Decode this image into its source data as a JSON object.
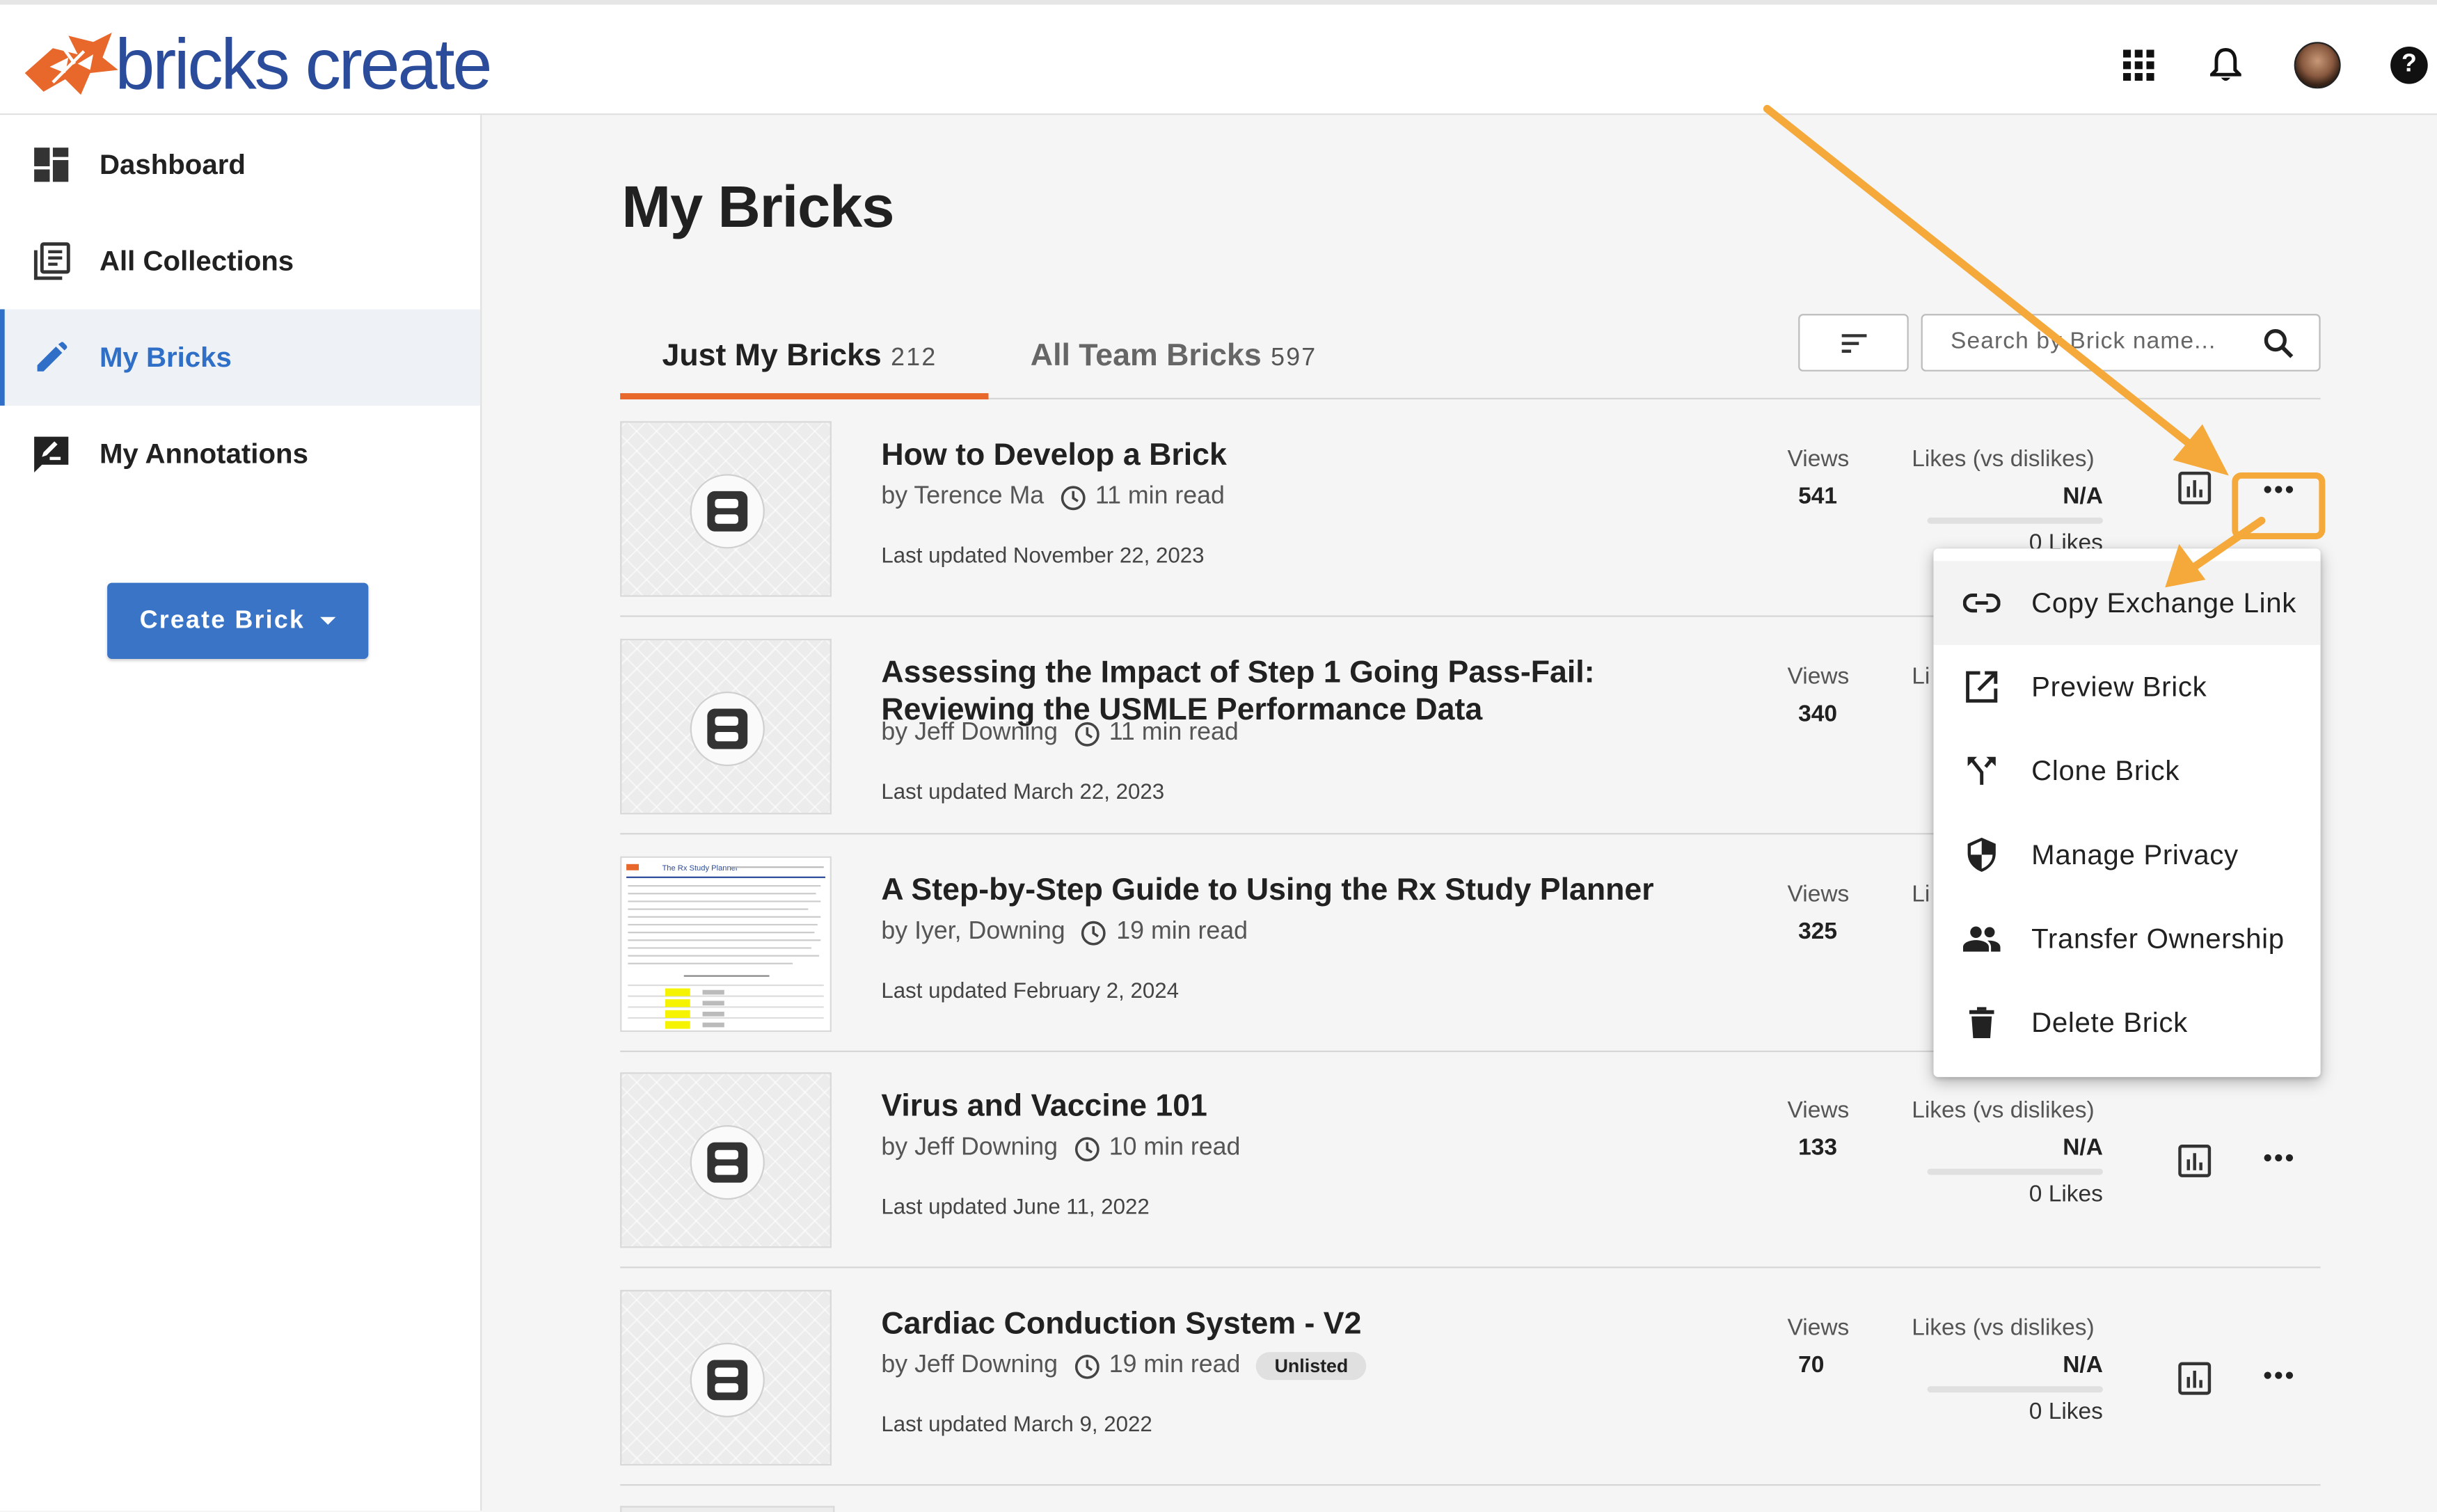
{
  "app": {
    "logo_text": "bricks create",
    "colors": {
      "brand_blue": "#2b4b9b",
      "brand_orange": "#e8672a",
      "accent": "#3a74c7",
      "annotation": "#f4a93a"
    }
  },
  "topbar": {
    "icons": [
      "apps-grid-icon",
      "bell-icon",
      "avatar",
      "help-icon"
    ],
    "help_label": "?"
  },
  "sidebar": {
    "items": [
      {
        "label": "Dashboard",
        "icon": "dashboard-icon",
        "active": false
      },
      {
        "label": "All Collections",
        "icon": "collections-icon",
        "active": false
      },
      {
        "label": "My Bricks",
        "icon": "pencil-icon",
        "active": true
      },
      {
        "label": "My Annotations",
        "icon": "annotation-icon",
        "active": false
      }
    ],
    "create_button": "Create Brick"
  },
  "main": {
    "title": "My Bricks",
    "tabs": [
      {
        "label": "Just My Bricks",
        "count": "212",
        "active": true
      },
      {
        "label": "All Team Bricks",
        "count": "597",
        "active": false
      }
    ],
    "search": {
      "placeholder": "Search by Brick name..."
    },
    "bricks": [
      {
        "title": "How to Develop a Brick",
        "author": "by Terence Ma",
        "read_time": "11 min read",
        "updated": "Last updated November 22, 2023",
        "views_label": "Views",
        "views": "541",
        "likes_label": "Likes (vs dislikes)",
        "likes_value": "N/A",
        "likes_count": "0 Likes",
        "badge": ""
      },
      {
        "title": "Assessing the Impact of Step 1 Going Pass-Fail: Reviewing the USMLE Performance Data",
        "author": "by Jeff Downing",
        "read_time": "11 min read",
        "updated": "Last updated March 22, 2023",
        "views_label": "Views",
        "views": "340",
        "likes_label": "Li",
        "likes_value": "",
        "likes_count": "",
        "badge": ""
      },
      {
        "title": "A Step-by-Step Guide to Using the Rx Study Planner",
        "author": "by Iyer, Downing",
        "read_time": "19 min read",
        "updated": "Last updated February 2, 2024",
        "views_label": "Views",
        "views": "325",
        "likes_label": "Li",
        "likes_value": "",
        "likes_count": "",
        "badge": ""
      },
      {
        "title": "Virus and Vaccine 101",
        "author": "by Jeff Downing",
        "read_time": "10 min read",
        "updated": "Last updated June 11, 2022",
        "views_label": "Views",
        "views": "133",
        "likes_label": "Likes (vs dislikes)",
        "likes_value": "N/A",
        "likes_count": "0 Likes",
        "badge": ""
      },
      {
        "title": "Cardiac Conduction System - V2",
        "author": "by Jeff Downing",
        "read_time": "19 min read",
        "updated": "Last updated March 9, 2022",
        "views_label": "Views",
        "views": "70",
        "likes_label": "Likes (vs dislikes)",
        "likes_value": "N/A",
        "likes_count": "0 Likes",
        "badge": "Unlisted"
      }
    ],
    "thumb_doc": {
      "title": "The Rx Study Planner"
    }
  },
  "menu": {
    "items": [
      {
        "label": "Copy Exchange Link",
        "icon": "link-icon"
      },
      {
        "label": "Preview Brick",
        "icon": "open-external-icon"
      },
      {
        "label": "Clone Brick",
        "icon": "fork-icon"
      },
      {
        "label": "Manage Privacy",
        "icon": "shield-icon"
      },
      {
        "label": "Transfer Ownership",
        "icon": "people-icon"
      },
      {
        "label": "Delete Brick",
        "icon": "trash-icon"
      }
    ]
  }
}
